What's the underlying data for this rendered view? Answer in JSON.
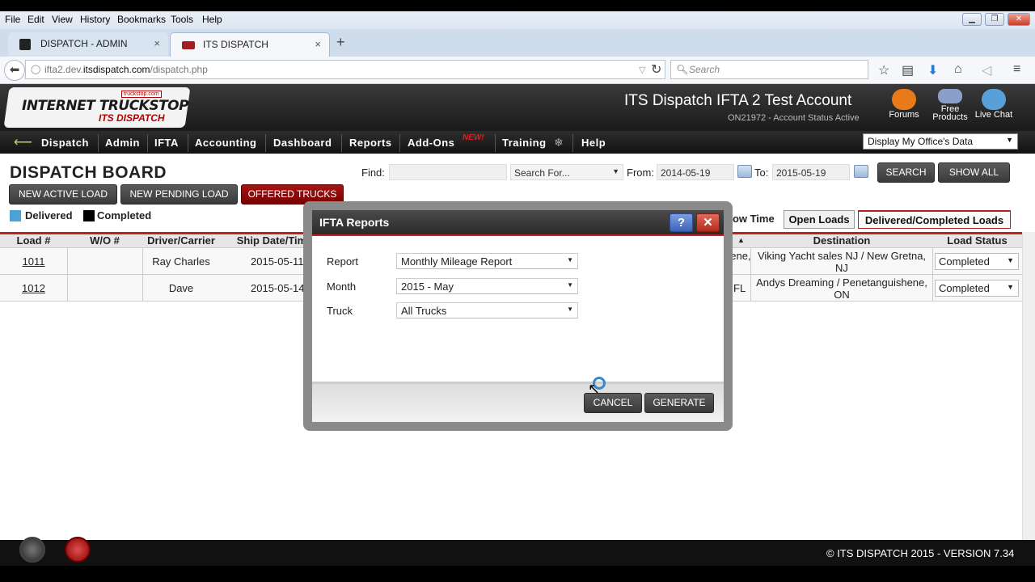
{
  "browser": {
    "menu": [
      "File",
      "Edit",
      "View",
      "History",
      "Bookmarks",
      "Tools",
      "Help"
    ],
    "tabs": [
      {
        "label": "DISPATCH - ADMIN"
      },
      {
        "label": "ITS DISPATCH"
      }
    ],
    "url_prefix": "ifta2.dev.",
    "url_host": "itsdispatch.com",
    "url_path": "/dispatch.php",
    "search_placeholder": "Search"
  },
  "header": {
    "logo_main": "INTERNET TRUCKSTOP",
    "logo_sub": "ITS DISPATCH",
    "logo_tag": "truckstop.com",
    "account_name": "ITS Dispatch IFTA 2 Test Account",
    "account_status": "ON21972 - Account Status Active",
    "icons": [
      {
        "label": "Forums",
        "icon": "forums-icon"
      },
      {
        "label": "Free Products",
        "icon": "handshake-icon"
      },
      {
        "label": "Live Chat",
        "icon": "users-icon"
      }
    ]
  },
  "nav": {
    "items": [
      "Dispatch",
      "Admin",
      "IFTA",
      "Accounting",
      "Dashboard",
      "Reports",
      "Add-Ons",
      "Training",
      "Help"
    ],
    "new_badge": "NEW!",
    "office_select": "Display My Office's Data"
  },
  "board": {
    "title": "DISPATCH BOARD",
    "find_label": "Find:",
    "search_for": "Search For...",
    "from_label": "From:",
    "from_value": "2014-05-19",
    "to_label": "To:",
    "to_value": "2015-05-19",
    "search_btn": "SEARCH",
    "show_all_btn": "SHOW ALL",
    "new_active": "NEW ACTIVE LOAD",
    "new_pending": "NEW PENDING LOAD",
    "offered": "OFFERED TRUCKS",
    "legend": [
      {
        "label": "Delivered",
        "color": "#4aa3d4"
      },
      {
        "label": "Completed",
        "color": "#000000"
      }
    ],
    "show_time": "how Time",
    "tab_open": "Open Loads",
    "tab_delivered": "Delivered/Completed Loads",
    "columns": [
      "Load #",
      "W/O #",
      "Driver/Carrier",
      "Ship Date/Tim",
      "Destination",
      "Load Status"
    ],
    "rows": [
      {
        "load": "1011",
        "wo": "",
        "driver": "Ray Charles",
        "ship": "2015-05-11",
        "origin_tail": "hene,",
        "dest1": "Viking Yacht sales NJ / New Gretna,",
        "dest2": "NJ",
        "status": "Completed"
      },
      {
        "load": "1012",
        "wo": "",
        "driver": "Dave",
        "ship": "2015-05-14",
        "origin_tail": ", FL",
        "dest1": "Andys Dreaming / Penetanguishene,",
        "dest2": "ON",
        "status": "Completed"
      }
    ]
  },
  "modal": {
    "title": "IFTA Reports",
    "help": "?",
    "close": "✕",
    "fields": [
      {
        "label": "Report",
        "value": "Monthly Mileage Report"
      },
      {
        "label": "Month",
        "value": "2015 - May"
      },
      {
        "label": "Truck",
        "value": "All Trucks"
      }
    ],
    "cancel": "CANCEL",
    "generate": "GENERATE"
  },
  "footer": {
    "copyright": "© ITS DISPATCH 2015  -  VERSION 7.34"
  },
  "colors": {
    "accent_red": "#c02020",
    "header_dark": "#1a1a1a"
  }
}
